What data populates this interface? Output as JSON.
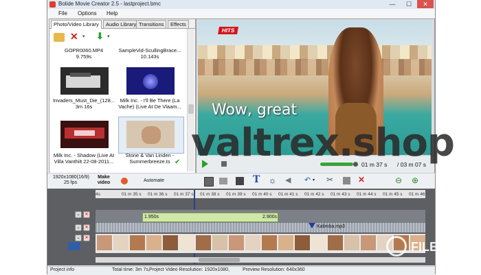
{
  "window": {
    "title": "Bolide Movie Creator 2.5 - lastproject.bmc",
    "minimize": "—",
    "maximize": "☐",
    "close": "✕"
  },
  "menu": [
    "File",
    "Options",
    "Help"
  ],
  "library": {
    "tabs": [
      "Photo/Video Library",
      "Audio Library",
      "Transitions",
      "Effects"
    ],
    "items": [
      {
        "name": "GOPR0060.MP4",
        "duration": "9.759s"
      },
      {
        "name": "SampleVid-ScullingBrace...",
        "duration": "10.143s"
      },
      {
        "name": "Invaders_Must_Die_(128...",
        "duration": "3m 16s"
      },
      {
        "name": "Milk Inc. - I'll Be There (La Vache) (Live At De Vlaam...",
        "duration": ""
      },
      {
        "name": "Milk Inc. - Shadow (Live At Villa Vanthilt 22-08-2011...",
        "duration": ""
      },
      {
        "name": "Stone & Van Linden - Summerbreeze.ts",
        "duration": ""
      }
    ]
  },
  "preview": {
    "badge": "HITS",
    "subtitle": "Wow, great",
    "current_time": "01 m 37 s",
    "total_time": "/ 03 m 07 s"
  },
  "toolbar": {
    "resolution": "1920x1080(16/9)",
    "fps": "25 fps",
    "make_video": "Make video",
    "automate": "Automate"
  },
  "timeline": {
    "ticks": [
      "4s",
      "01 m 35 s",
      "01 m 36 s",
      "01 m 37 s",
      "01 m 38 s",
      "01 m 39 s",
      "01 m 40 s",
      "01 m 41 s",
      "01 m 42 s",
      "01 m 43 s",
      "01 m 44 s",
      "01 m 45 s",
      "01 m 46"
    ],
    "clip_start": "1.950s",
    "clip_end": "2.900s",
    "audio_clip": "Kalimba.mp3"
  },
  "status": {
    "project_info": "Project info",
    "total_time": "Total time: 3m 7s,",
    "video_resolution": "Project Video Resolution:   1920x1080,",
    "preview_resolution": "Preview Resolution:    640x360"
  },
  "overlay": {
    "watermark": "valtrex.shop",
    "logo_text": "FILECR"
  }
}
